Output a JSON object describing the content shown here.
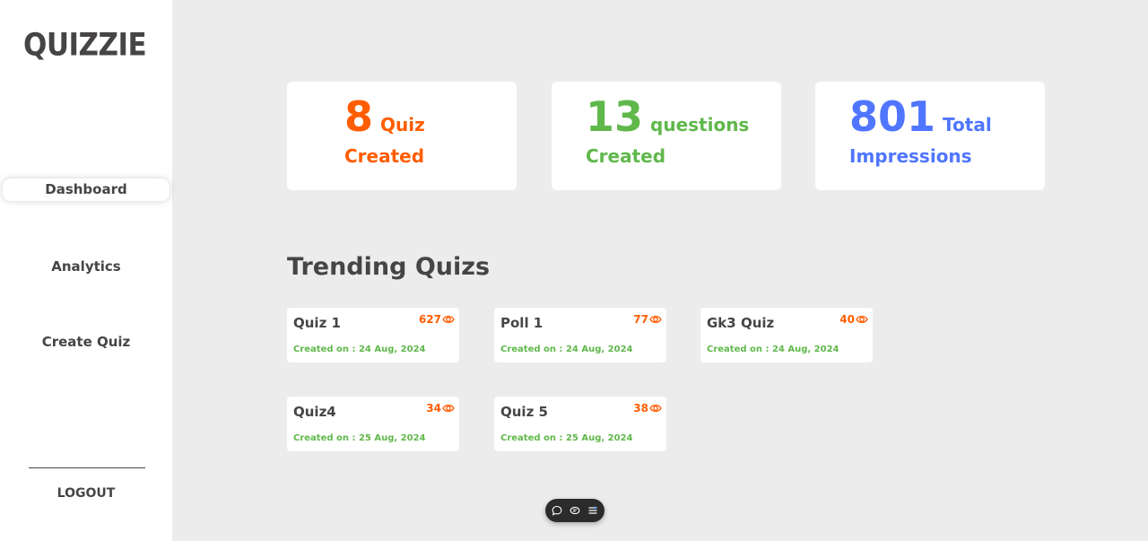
{
  "sidebar": {
    "logo": "QUIZZIE",
    "nav": [
      {
        "label": "Dashboard",
        "active": true
      },
      {
        "label": "Analytics",
        "active": false
      },
      {
        "label": "Create Quiz",
        "active": false
      }
    ],
    "logout_label": "LOGOUT"
  },
  "stats": [
    {
      "value": "8",
      "word": "Quiz",
      "sub": "Created",
      "color": "#ff5d01"
    },
    {
      "value": "13",
      "word": "questions",
      "sub": "Created",
      "color": "#60b84b"
    },
    {
      "value": "801",
      "word": "Total",
      "sub": "Impressions",
      "color": "#5076ff"
    }
  ],
  "trending": {
    "title": "Trending Quizs",
    "items": [
      {
        "name": "Quiz 1",
        "views": "627",
        "date": "Created on : 24 Aug, 2024"
      },
      {
        "name": "Poll 1",
        "views": "77",
        "date": "Created on : 24 Aug, 2024"
      },
      {
        "name": "Gk3 Quiz",
        "views": "40",
        "date": "Created on : 24 Aug, 2024"
      },
      {
        "name": "Quiz4",
        "views": "34",
        "date": "Created on : 25 Aug, 2024"
      },
      {
        "name": "Quiz 5",
        "views": "38",
        "date": "Created on : 25 Aug, 2024"
      }
    ],
    "view_icon": "eye-icon"
  },
  "float_toolbar": {
    "icons": [
      "comment-icon",
      "chat-icon",
      "menu-icon"
    ]
  },
  "colors": {
    "orange": "#ff5d01",
    "green": "#60b84b",
    "blue": "#5076ff",
    "text": "#474444",
    "background": "#ececec"
  }
}
